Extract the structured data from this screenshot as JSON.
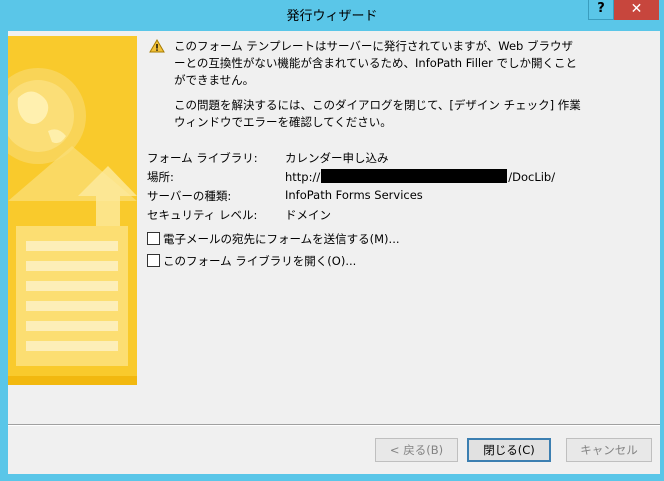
{
  "window": {
    "title": "発行ウィザード",
    "help_label": "?",
    "close_label": "✕"
  },
  "message": {
    "warning_text": "このフォーム テンプレートはサーバーに発行されていますが、Web ブラウザーとの互換性がない機能が含まれているため、InfoPath Filler でしか開くことができません。",
    "resolution_text": "この問題を解決するには、このダイアログを閉じて、[デザイン チェック] 作業ウィンドウでエラーを確認してください。"
  },
  "details": {
    "library_label": "フォーム ライブラリ:",
    "library_value": "カレンダー申し込み",
    "location_label": "場所:",
    "location_prefix": "http://",
    "location_suffix": "/DocLib/",
    "server_type_label": "サーバーの種類:",
    "server_type_value": "InfoPath Forms Services",
    "security_label": "セキュリティ レベル:",
    "security_value": "ドメイン"
  },
  "options": {
    "email_checkbox_label": "電子メールの宛先にフォームを送信する(M)...",
    "email_checked": false,
    "open_library_checkbox_label": "このフォーム ライブラリを開く(O)...",
    "open_library_checked": false
  },
  "buttons": {
    "back_label": "< 戻る(B)",
    "close_label": "閉じる(C)",
    "cancel_label": "キャンセル"
  }
}
